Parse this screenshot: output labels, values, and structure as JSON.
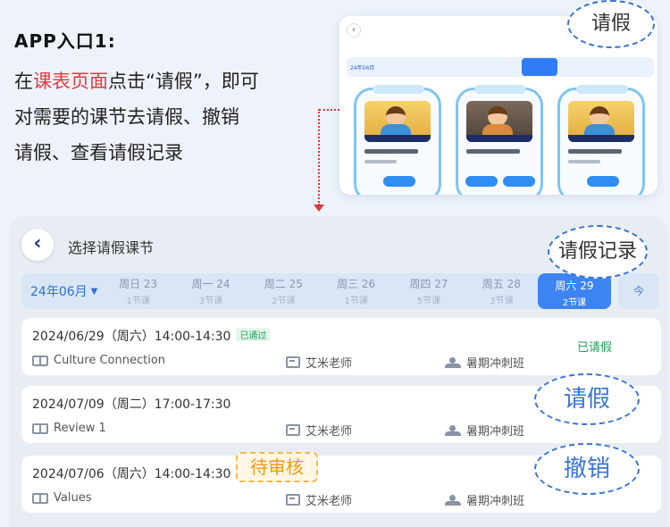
{
  "intro": {
    "heading": "APP入口1:",
    "desc_prefix": "在",
    "desc_highlight": "课表页面",
    "desc_line1_rest": "点击“请假”，即可",
    "desc_line2": "对需要的课节去请假、撤销",
    "desc_line3": "请假、查看请假记录"
  },
  "preview": {
    "back_icon": "chevron-left-icon",
    "month": "24年06月",
    "bubble": "请假",
    "cards": [
      "card-1",
      "card-2",
      "card-3"
    ]
  },
  "page": {
    "title": "选择请假课节",
    "record_bubble": "请假记录"
  },
  "datebar": {
    "month": "24年06月",
    "days": [
      {
        "label": "周日 23",
        "count": "1节课"
      },
      {
        "label": "周一 24",
        "count": "3节课"
      },
      {
        "label": "周二 25",
        "count": "2节课"
      },
      {
        "label": "周三 26",
        "count": "1节课"
      },
      {
        "label": "周四 27",
        "count": "5节课"
      },
      {
        "label": "周五 28",
        "count": "3节课"
      },
      {
        "label": "周六 29",
        "count": "2节课",
        "active": true
      }
    ],
    "today": "今"
  },
  "lessons": [
    {
      "time": "2024/06/29（周六）14:00-14:30",
      "badge": "已通过",
      "course": "Culture Connection",
      "teacher": "艾米老师",
      "class": "暑期冲刺班",
      "status": "已请假"
    },
    {
      "time": "2024/07/09（周二）17:00-17:30",
      "course": "Review 1",
      "teacher": "艾米老师",
      "class": "暑期冲刺班",
      "action": "请假"
    },
    {
      "time": "2024/07/06（周六）14:00-14:30",
      "badge": "待审核",
      "course": "Values",
      "teacher": "艾米老师",
      "class": "暑期冲刺班",
      "action": "撤销"
    }
  ],
  "colors": {
    "accent": "#3d84f3",
    "highlight": "#e23b3b",
    "approved": "#21a05b",
    "pending": "#f09a14"
  }
}
